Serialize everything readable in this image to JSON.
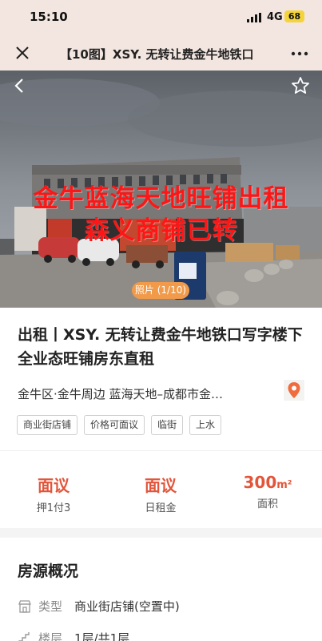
{
  "status_bar": {
    "time": "15:10",
    "network": "4G",
    "battery": "68"
  },
  "nav": {
    "title": "【10图】XSY. 无转让费金牛地铁口"
  },
  "photo": {
    "overlay_line1": "金牛蓝海天地旺铺出租",
    "overlay_line2": "森义商铺已转",
    "counter": "照片 (1/10)"
  },
  "listing": {
    "title": "出租丨XSY. 无转让费金牛地铁口写字楼下全业态旺铺房东直租",
    "address": "金牛区·金牛周边 蓝海天地–成都市金…",
    "tags": [
      "商业街店铺",
      "价格可面议",
      "临街",
      "上水"
    ]
  },
  "stats": [
    {
      "value": "面议",
      "unit": "",
      "label": "押1付3"
    },
    {
      "value": "面议",
      "unit": "",
      "label": "日租金"
    },
    {
      "value": "300",
      "unit": "m²",
      "label": "面积"
    }
  ],
  "overview": {
    "title": "房源概况",
    "rows": [
      {
        "label": "类型",
        "value": "商业街店铺(空置中)",
        "icon": "storefront-icon"
      },
      {
        "label": "楼层",
        "value": "1层/共1层",
        "icon": "stairs-icon"
      }
    ]
  },
  "colors": {
    "accent": "#e2553a",
    "header_bg": "#f3e6e0",
    "overlay_text": "#ff1515",
    "counter_bg": "#f19a4a"
  }
}
